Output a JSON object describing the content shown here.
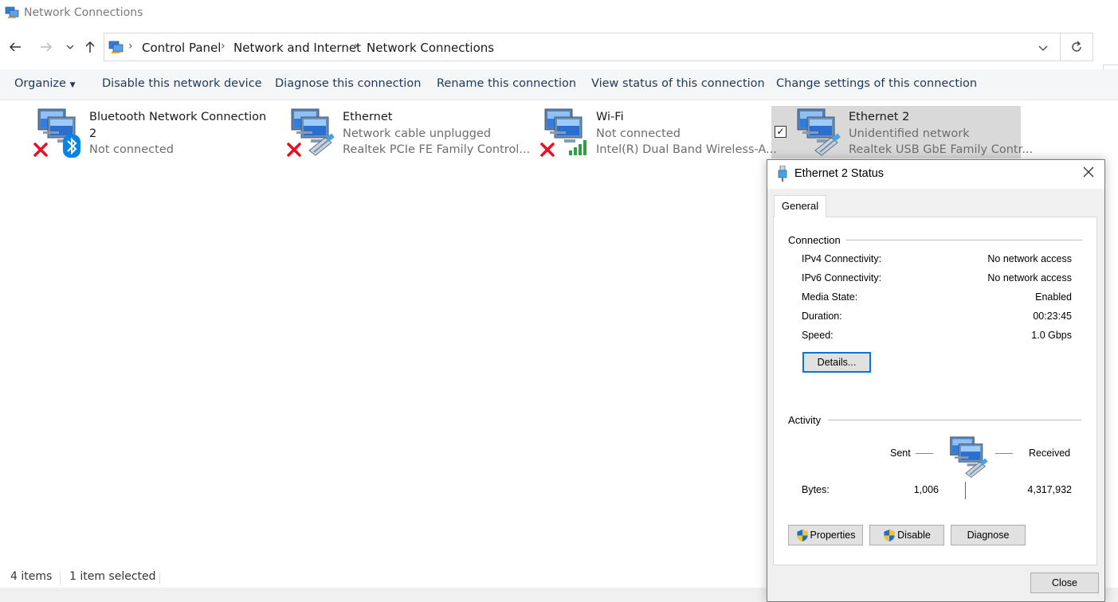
{
  "window": {
    "title": "Network Connections",
    "icon": "network-connections-icon"
  },
  "nav": {
    "back_icon": "arrow-left-icon",
    "forward_icon": "arrow-right-icon",
    "recent_icon": "chevron-down-icon",
    "up_icon": "arrow-up-icon",
    "breadcrumbs": [
      "Control Panel",
      "Network and Internet",
      "Network Connections"
    ],
    "refresh_icon": "refresh-icon"
  },
  "commands": {
    "organize": "Organize",
    "disable": "Disable this network device",
    "diagnose": "Diagnose this connection",
    "rename": "Rename this connection",
    "view_status": "View status of this connection",
    "change_settings": "Change settings of this connection"
  },
  "connections": [
    {
      "name_line1": "Bluetooth Network Connection",
      "name_line2": "2",
      "status": "Not connected",
      "device": "",
      "badge": "bluetooth-icon",
      "error": true
    },
    {
      "name_line1": "Ethernet",
      "status": "Network cable unplugged",
      "device": "Realtek PCIe FE Family Control...",
      "badge": "ethernet-cable-icon",
      "error": true
    },
    {
      "name_line1": "Wi-Fi",
      "status": "Not connected",
      "device": "Intel(R) Dual Band Wireless-A...",
      "badge": "wifi-signal-icon",
      "error": true
    },
    {
      "name_line1": "Ethernet 2",
      "status": "Unidentified network",
      "device": "Realtek USB GbE Family Contr...",
      "badge": "ethernet-cable-icon",
      "error": false,
      "selected": true
    }
  ],
  "statusbar": {
    "items": "4 items",
    "selected": "1 item selected"
  },
  "dialog": {
    "title": "Ethernet 2 Status",
    "tab": "General",
    "connection_label": "Connection",
    "rows": [
      {
        "label": "IPv4 Connectivity:",
        "value": "No network access"
      },
      {
        "label": "IPv6 Connectivity:",
        "value": "No network access"
      },
      {
        "label": "Media State:",
        "value": "Enabled"
      },
      {
        "label": "Duration:",
        "value": "00:23:45"
      },
      {
        "label": "Speed:",
        "value": "1.0 Gbps"
      }
    ],
    "details_button": "Details...",
    "activity_label": "Activity",
    "sent_label": "Sent",
    "received_label": "Received",
    "bytes_label": "Bytes:",
    "bytes_sent": "1,006",
    "bytes_received": "4,317,932",
    "properties_button": "Properties",
    "disable_button": "Disable",
    "diagnose_button": "Diagnose",
    "close_button": "Close"
  },
  "colors": {
    "command_text": "#1e395b",
    "selection": "#d9d9d9",
    "error_red": "#e81123",
    "accent": "#0078d7"
  }
}
